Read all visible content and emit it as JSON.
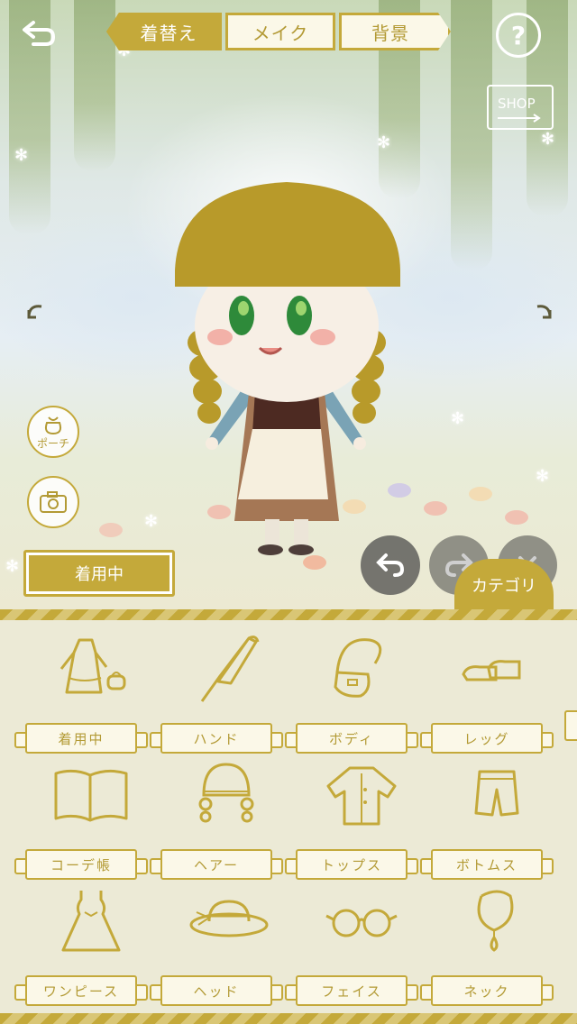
{
  "tabs": [
    {
      "label": "着替え",
      "active": true
    },
    {
      "label": "メイク",
      "active": false
    },
    {
      "label": "背景",
      "active": false
    }
  ],
  "shop_label": "SHOP",
  "help_label": "?",
  "side_buttons": {
    "pouch_label": "ポーチ"
  },
  "wearing_button_label": "着用中",
  "category_label": "カテゴリ",
  "colors": {
    "gold": "#c4a93a",
    "cream": "#fbf8e8",
    "panel": "#ecead6"
  },
  "categories": [
    {
      "label": "着用中",
      "icon": "dress-and-bag-icon"
    },
    {
      "label": "ハンド",
      "icon": "umbrella-icon"
    },
    {
      "label": "ボディ",
      "icon": "shoulder-bag-icon"
    },
    {
      "label": "レッグ",
      "icon": "shoes-icon"
    },
    {
      "label": "コーデ帳",
      "icon": "open-book-icon"
    },
    {
      "label": "ヘアー",
      "icon": "braided-hair-icon"
    },
    {
      "label": "トップス",
      "icon": "shirt-icon"
    },
    {
      "label": "ボトムス",
      "icon": "shorts-icon"
    },
    {
      "label": "ワンピース",
      "icon": "one-piece-dress-icon"
    },
    {
      "label": "ヘッド",
      "icon": "hat-icon"
    },
    {
      "label": "フェイス",
      "icon": "glasses-icon"
    },
    {
      "label": "ネック",
      "icon": "necklace-icon"
    }
  ]
}
